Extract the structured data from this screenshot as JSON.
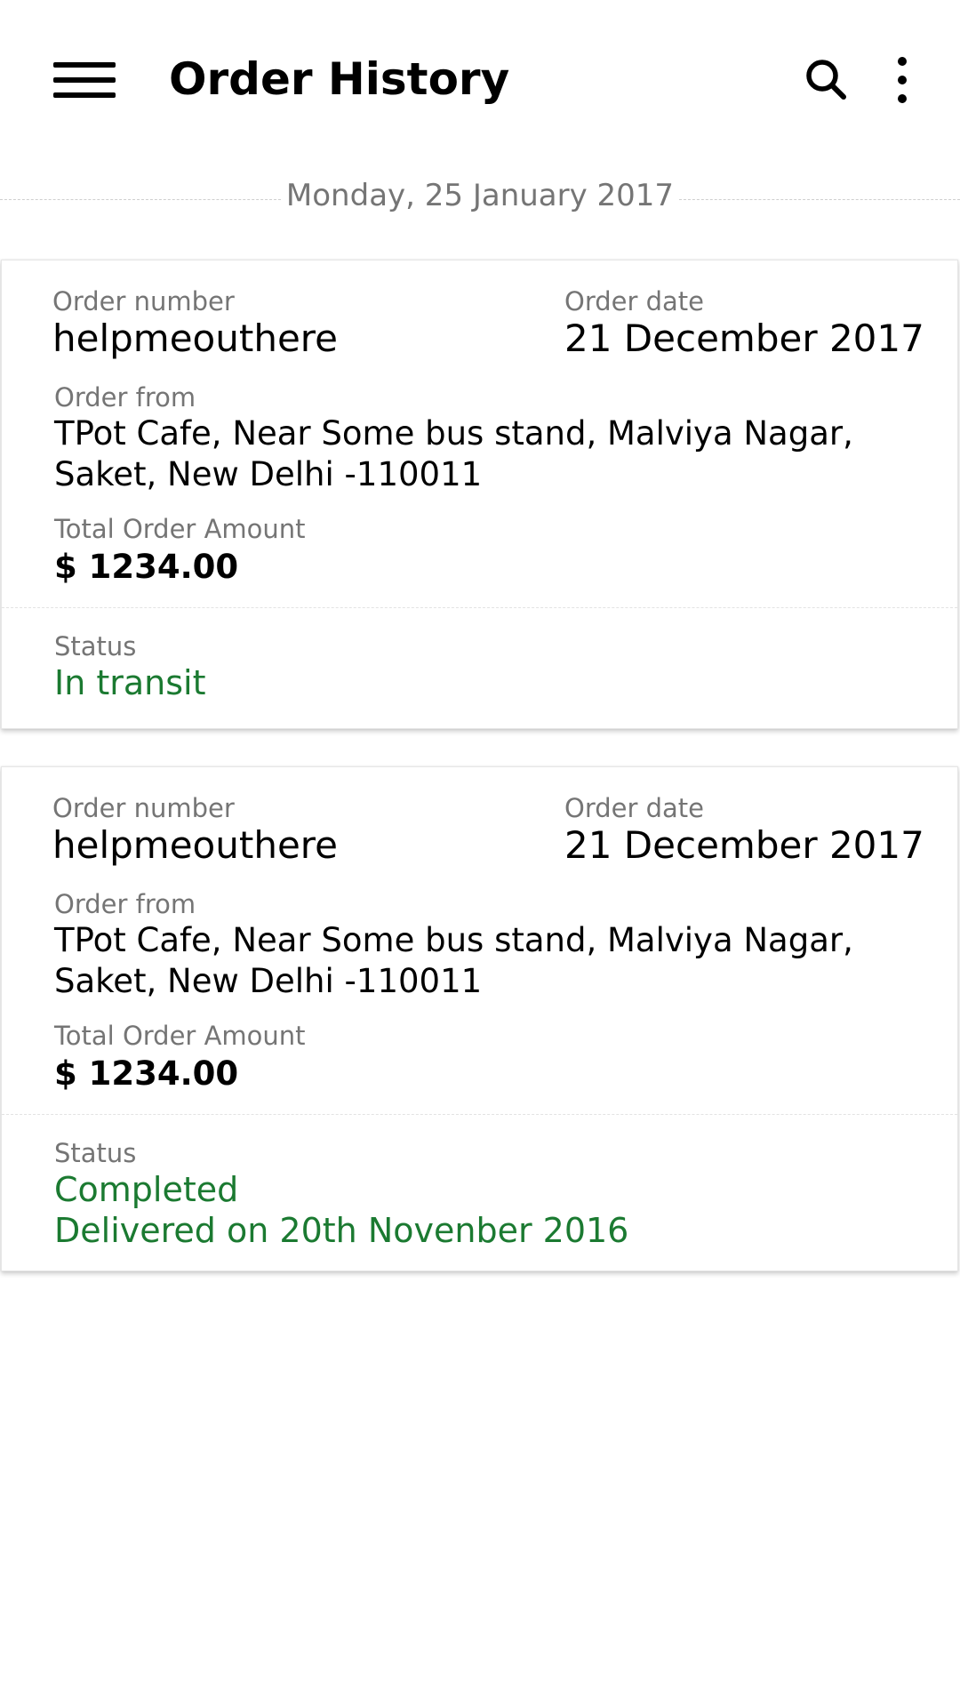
{
  "app_bar": {
    "title": "Order History",
    "menu_icon": "hamburger-menu-icon",
    "search_icon": "search-icon",
    "more_icon": "more-vertical-icon"
  },
  "date_header": "Monday, 25 January 2017",
  "colors": {
    "status_green": "#1b7a31",
    "label_gray": "#757575"
  },
  "orders": [
    {
      "order_number_label": "Order number",
      "order_number": "helpmeouthere",
      "order_date_label": "Order date",
      "order_date": "21 December 2017",
      "order_from_label": "Order from",
      "order_from_line1": "TPot Cafe, Near Some bus stand, Malviya Nagar,",
      "order_from_line2": "Saket, New Delhi -110011",
      "total_label": "Total Order Amount",
      "total": "$ 1234.00",
      "status_label": "Status",
      "status": "In transit"
    },
    {
      "order_number_label": "Order number",
      "order_number": "helpmeouthere",
      "order_date_label": "Order date",
      "order_date": "21 December 2017",
      "order_from_label": "Order from",
      "order_from_line1": "TPot Cafe, Near Some bus stand, Malviya Nagar,",
      "order_from_line2": "Saket, New Delhi -110011",
      "total_label": "Total Order Amount",
      "total": "$ 1234.00",
      "status_label": "Status",
      "status": "Completed",
      "status_detail": "Delivered on 20th Novenber 2016"
    }
  ]
}
